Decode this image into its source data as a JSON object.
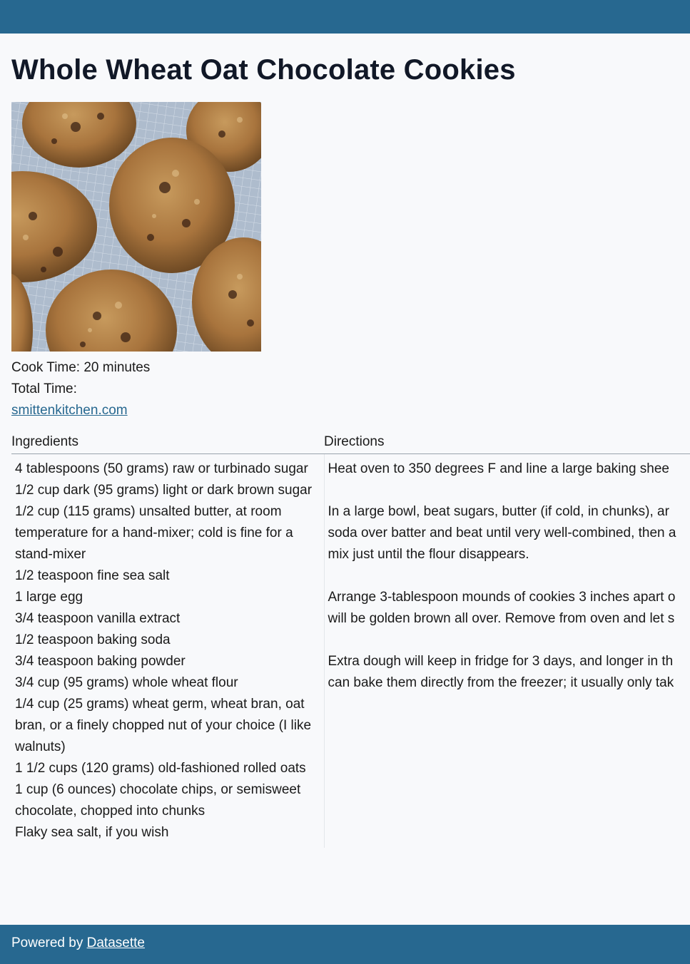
{
  "recipe": {
    "title": "Whole Wheat Oat Chocolate Cookies",
    "image_alt": "",
    "cook_time_label": "Cook Time: 20 minutes",
    "total_time_label": "Total Time:",
    "source_link": "smittenkitchen.com"
  },
  "table": {
    "ingredients_header": "Ingredients",
    "directions_header": "Directions",
    "ingredients": [
      "4 tablespoons (50 grams) raw or turbinado sugar",
      "1/2 cup dark (95 grams) light or dark brown sugar",
      "1/2 cup (115 grams) unsalted butter, at room temperature for a hand-mixer; cold is fine for a stand-mixer",
      "1/2 teaspoon fine sea salt",
      "1 large egg",
      "3/4 teaspoon vanilla extract",
      "1/2 teaspoon baking soda",
      "3/4 teaspoon baking powder",
      "3/4 cup (95 grams) whole wheat flour",
      "1/4 cup (25 grams) wheat germ, wheat bran, oat bran, or a finely chopped nut of your choice (I like walnuts)",
      "1 1/2 cups (120 grams) old-fashioned rolled oats",
      "1 cup (6 ounces) chocolate chips, or semisweet chocolate, chopped into chunks",
      "Flaky sea salt, if you wish"
    ],
    "directions": [
      [
        "Heat oven to 350 degrees F and line a large baking shee"
      ],
      [
        "In a large bowl, beat sugars, butter (if cold, in chunks), ar",
        "soda over batter and beat until very well-combined, then a",
        "mix just until the flour disappears."
      ],
      [
        "Arrange 3-tablespoon mounds of cookies 3 inches apart o",
        "will be golden brown all over. Remove from oven and let s"
      ],
      [
        "Extra dough will keep in fridge for 3 days, and longer in th",
        "can bake them directly from the freezer; it usually only tak"
      ]
    ]
  },
  "footer": {
    "powered_by": "Powered by",
    "link": "Datasette"
  },
  "colors": {
    "bar": "#276890",
    "background": "#f8f9fb",
    "link": "#276890"
  }
}
